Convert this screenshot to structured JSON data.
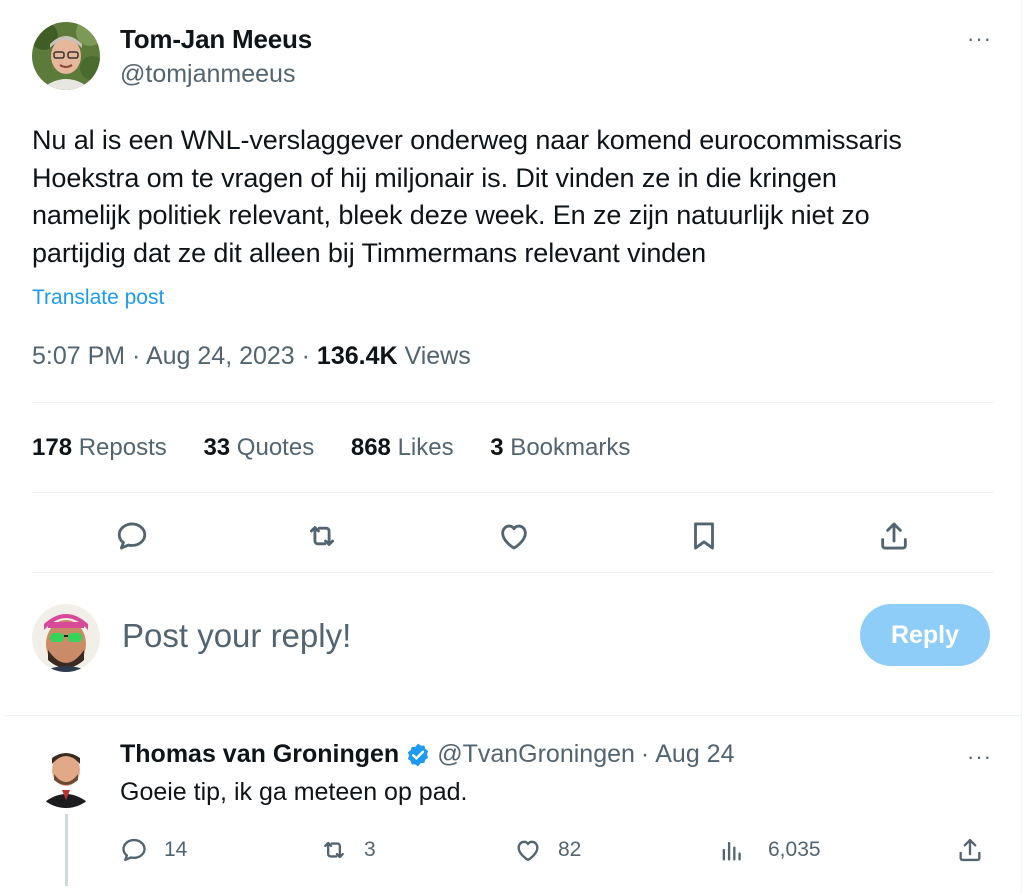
{
  "tweet": {
    "author_name": "Tom-Jan Meeus",
    "author_handle": "@tomjanmeeus",
    "more_label": "···",
    "text": "Nu al is een WNL-verslaggever onderweg naar komend eurocommissaris\nHoekstra om te vragen of hij miljonair is. Dit vinden ze in die kringen\nnamelijk politiek relevant, bleek deze week. En ze zijn natuurlijk niet zo\npartijdig dat ze dit alleen bij Timmermans relevant vinden",
    "translate_label": "Translate post",
    "time": "5:07 PM",
    "date": "Aug 24, 2023",
    "separator": " · ",
    "views_count": "136.4K",
    "views_label": " Views"
  },
  "stats": {
    "reposts_count": "178",
    "reposts_label": " Reposts",
    "quotes_count": "33",
    "quotes_label": " Quotes",
    "likes_count": "868",
    "likes_label": " Likes",
    "bookmarks_count": "3",
    "bookmarks_label": " Bookmarks"
  },
  "actions": [
    "reply-icon",
    "repost-icon",
    "like-icon",
    "bookmark-icon",
    "share-icon"
  ],
  "composer": {
    "placeholder": "Post your reply!",
    "button_label": "Reply",
    "button_color": "#8ecdf8"
  },
  "reply": {
    "author_name": "Thomas van Groningen",
    "author_handle": "@TvanGroningen",
    "dot": "·",
    "time": "Aug 24",
    "more_label": "···",
    "text": "Goeie tip, ik ga meteen op pad.",
    "replies": "14",
    "reposts": "3",
    "likes": "82",
    "views": "6,035"
  },
  "colors": {
    "text": "#0f1419",
    "secondary": "#536471",
    "link": "#1d9bf0",
    "divider": "#eff3f4",
    "verified": "#1d9bf0"
  }
}
